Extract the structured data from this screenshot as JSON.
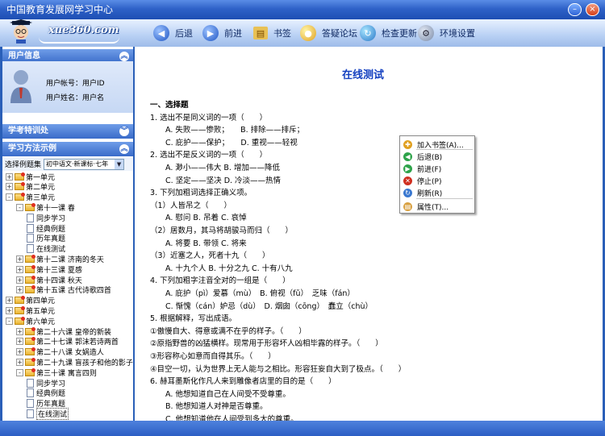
{
  "window": {
    "title": "中国教育发展网学习中心",
    "min_label": "–",
    "close_label": "×"
  },
  "logo": {
    "brand": "xue360.com"
  },
  "nav": [
    {
      "label": "后退",
      "icon": "back-icon",
      "glyph": "◀"
    },
    {
      "label": "前进",
      "icon": "forward-icon",
      "glyph": "▶"
    },
    {
      "label": "书签",
      "icon": "bookmark-icon",
      "glyph": "▤"
    },
    {
      "label": "答疑论坛",
      "icon": "forum-icon",
      "glyph": "●"
    },
    {
      "label": "检查更新",
      "icon": "update-icon",
      "glyph": "↻"
    },
    {
      "label": "环境设置",
      "icon": "settings-icon",
      "glyph": "⚙"
    }
  ],
  "sidebar": {
    "user_info_title": "用户信息",
    "user_account_label": "用户帐号：用户ID",
    "user_name_label": "用户姓名：用户名",
    "exam_title": "学考特训处",
    "method_title": "学习方法示例",
    "select_label": "选择例题集",
    "select_value": "初中语文·新课标·七年",
    "collapse_glyph": "︽",
    "expand_glyph": "︾",
    "tree": [
      {
        "label": "第一单元",
        "level": 0,
        "type": "folder",
        "toggle": "+"
      },
      {
        "label": "第二单元",
        "level": 0,
        "type": "folder",
        "toggle": "+"
      },
      {
        "label": "第三单元",
        "level": 0,
        "type": "folder",
        "toggle": "-"
      },
      {
        "label": "第十一课 春",
        "level": 1,
        "type": "folder",
        "toggle": "-"
      },
      {
        "label": "同步学习",
        "level": 2,
        "type": "doc"
      },
      {
        "label": "经典例题",
        "level": 2,
        "type": "doc"
      },
      {
        "label": "历年真题",
        "level": 2,
        "type": "doc"
      },
      {
        "label": "在线测试",
        "level": 2,
        "type": "doc"
      },
      {
        "label": "第十二课 济南的冬天",
        "level": 1,
        "type": "folder",
        "toggle": "+"
      },
      {
        "label": "第十三课 夏感",
        "level": 1,
        "type": "folder",
        "toggle": "+"
      },
      {
        "label": "第十四课 秋天",
        "level": 1,
        "type": "folder",
        "toggle": "+"
      },
      {
        "label": "第十五课 古代诗歌四首",
        "level": 1,
        "type": "folder",
        "toggle": "+"
      },
      {
        "label": "第四单元",
        "level": 0,
        "type": "folder",
        "toggle": "+"
      },
      {
        "label": "第五单元",
        "level": 0,
        "type": "folder",
        "toggle": "+"
      },
      {
        "label": "第六单元",
        "level": 0,
        "type": "folder",
        "toggle": "-"
      },
      {
        "label": "第二十六课 皇帝的新装",
        "level": 1,
        "type": "folder",
        "toggle": "+"
      },
      {
        "label": "第二十七课 郭沫若诗两首",
        "level": 1,
        "type": "folder",
        "toggle": "+"
      },
      {
        "label": "第二十八课 女娲造人",
        "level": 1,
        "type": "folder",
        "toggle": "+"
      },
      {
        "label": "第二十九课 盲孩子和他的影子",
        "level": 1,
        "type": "folder",
        "toggle": "+"
      },
      {
        "label": "第三十课 寓言四则",
        "level": 1,
        "type": "folder",
        "toggle": "-"
      },
      {
        "label": "同步学习",
        "level": 2,
        "type": "doc"
      },
      {
        "label": "经典例题",
        "level": 2,
        "type": "doc"
      },
      {
        "label": "历年真题",
        "level": 2,
        "type": "doc"
      },
      {
        "label": "在线测试",
        "level": 2,
        "type": "doc",
        "selected": true
      }
    ]
  },
  "content": {
    "title": "在线测试",
    "lines": [
      {
        "text": "一、选择题",
        "indent": 0,
        "bold": true
      },
      {
        "text": "1. 选出不是同义词的一项（　　）",
        "indent": 0
      },
      {
        "text": "A. 失败——惨败；　　B. 排除——排斥；",
        "indent": 1
      },
      {
        "text": "C. 庇护——保护；　　D. 重视——轻视",
        "indent": 1
      },
      {
        "text": "2. 选出不是反义词的一项（　　）",
        "indent": 0
      },
      {
        "text": "A. 渺小——伟大 B. 增加——降低",
        "indent": 1
      },
      {
        "text": "C. 坚定——坚决 D. 冷淡——热情",
        "indent": 1
      },
      {
        "text": "3. 下列加粗词选择正确义项。",
        "indent": 0
      },
      {
        "text": "（1）人皆吊之（　　）",
        "indent": 0
      },
      {
        "text": "A. 慰问 B. 吊着 C. 哀悼",
        "indent": 1
      },
      {
        "text": "（2）居数月，其马将胡骏马而归（　　）",
        "indent": 0
      },
      {
        "text": "A. 将要 B. 带领 C. 将来",
        "indent": 1
      },
      {
        "text": "（3）近塞之人，死者十九（　　）",
        "indent": 0
      },
      {
        "text": "A. 十九个人 B. 十分之九 C. 十有八九",
        "indent": 1
      },
      {
        "text": "4. 下列加粗字注音全对的一组是（　　）",
        "indent": 0
      },
      {
        "text": "A. 庇护（pì）爱慕（mù）　B. 俯视（fǔ）　乏味（fán）",
        "indent": 1
      },
      {
        "text": "C. 惭愧（cán）妒忌（dù）　D. 烟囱（cōng）　蠢立（chù）",
        "indent": 1
      },
      {
        "text": "5. 根据解释，写出成语。",
        "indent": 0
      },
      {
        "text": "①傲慢自大、得意或满不在乎的样子。（　　）",
        "indent": 0
      },
      {
        "text": "②原指野兽的凶猛横样。现常用于形容坏人凶相毕露的样子。（　　）",
        "indent": 0
      },
      {
        "text": "③形容称心如意而自得其乐。（　　）",
        "indent": 0
      },
      {
        "text": "④目空一切，认为世界上无人能与之相比。形容狂妄自大到了极点。（　　）",
        "indent": 0
      },
      {
        "text": "6. 赫耳墨斯化作凡人来到雕像者店里的目的是（　　）",
        "indent": 0
      },
      {
        "text": "A. 他想知道自己在人间受不受尊重。",
        "indent": 1
      },
      {
        "text": "B. 他想知道人对神是否尊重。",
        "indent": 1
      },
      {
        "text": "C. 他想知道他在人间受到多大的尊重。",
        "indent": 1
      }
    ]
  },
  "context_menu": [
    {
      "label": "加入书签(A)...",
      "icon": "add-bookmark-icon",
      "color": "#e0a020",
      "glyph": "✚"
    },
    {
      "label": "后退(B)",
      "icon": "back-icon",
      "color": "#2ea34a",
      "glyph": "◀"
    },
    {
      "label": "前进(F)",
      "icon": "forward-icon",
      "color": "#2ea34a",
      "glyph": "▶"
    },
    {
      "label": "停止(P)",
      "icon": "stop-icon",
      "color": "#d03020",
      "glyph": "✕"
    },
    {
      "label": "刷新(R)",
      "icon": "refresh-icon",
      "color": "#3a78d0",
      "glyph": "↻"
    },
    {
      "label": "属性(T)...",
      "icon": "properties-icon",
      "color": "#d8a040",
      "glyph": "▤"
    }
  ]
}
